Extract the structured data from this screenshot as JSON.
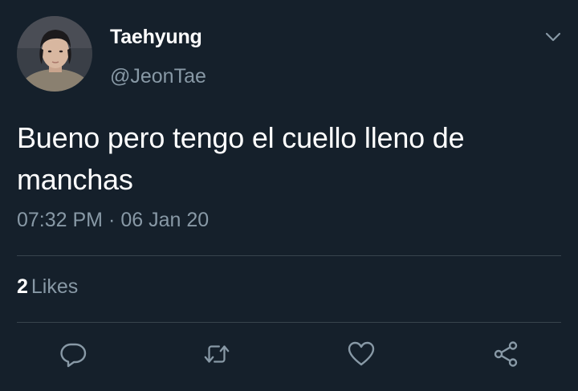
{
  "user": {
    "display_name": "Taehyung",
    "handle": "@JeonTae",
    "avatar": "avatar-photo"
  },
  "tweet": {
    "text": "Bueno pero tengo el cuello lleno de manchas",
    "time": "07:32 PM",
    "separator": "·",
    "date": "06 Jan 20"
  },
  "stats": {
    "likes_count": "2",
    "likes_label": "Likes"
  },
  "actions": [
    {
      "name": "reply",
      "icon": "speech-bubble-icon"
    },
    {
      "name": "retweet",
      "icon": "retweet-arrows-icon"
    },
    {
      "name": "like",
      "icon": "heart-icon"
    },
    {
      "name": "share",
      "icon": "share-nodes-icon"
    }
  ],
  "colors": {
    "background": "#15202b",
    "primary_text": "#ffffff",
    "secondary_text": "#8899a6",
    "divider": "#38444d"
  }
}
